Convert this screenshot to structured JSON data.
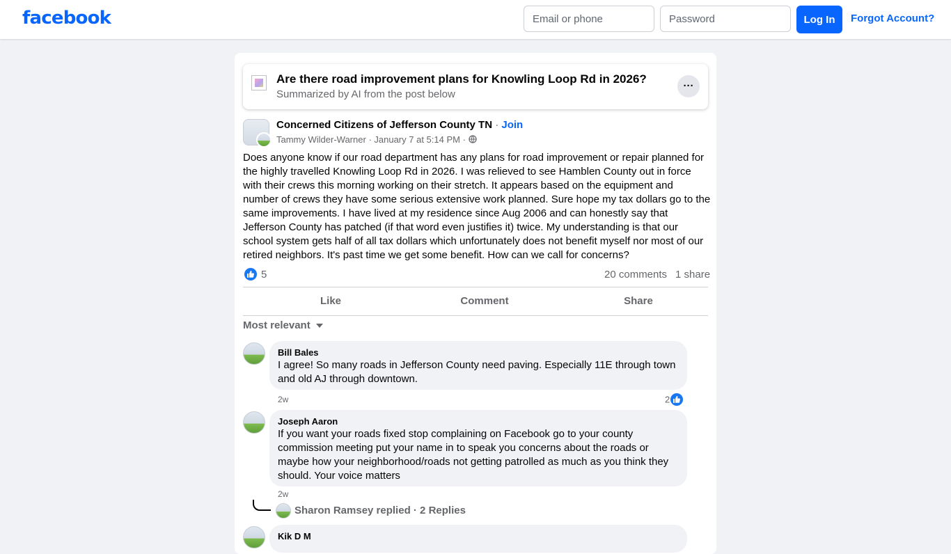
{
  "brand": {
    "logo": "facebook",
    "color": "#0866ff"
  },
  "login": {
    "email_placeholder": "Email or phone",
    "password_placeholder": "Password",
    "login_label": "Log In",
    "forgot_label": "Forgot Account?"
  },
  "summary": {
    "title": "Are there road improvement plans for Knowling Loop Rd in 2026?",
    "subtitle": "Summarized by AI from the post below",
    "more_label": "···"
  },
  "post": {
    "group_name": "Concerned Citizens of Jefferson County TN",
    "join_label": "Join",
    "author": "Tammy Wilder-Warner",
    "timestamp": "January 7 at 5:14 PM",
    "body": "Does anyone know if our road department has any plans for road improvement or repair planned for the highly travelled Knowling Loop Rd in 2026. I was relieved to see Hamblen County out in force with their crews this morning working on their stretch. It appears based on the equipment and number of crews they have some serious extensive work planned. Sure hope my tax dollars go to the same improvements. I have lived  at my residence since Aug 2006 and can honestly say that Jefferson County has patched (if that word even justifies it) twice. My understanding is that our school system gets half of all tax dollars which unfortunately does not benefit myself nor most of our retired neighbors. It's past time we get some benefit. How can we call for concerns?",
    "reaction_count": "5",
    "comments_count": "20 comments",
    "shares_count": "1 share",
    "actions": {
      "like": "Like",
      "comment": "Comment",
      "share": "Share"
    }
  },
  "comments_section": {
    "sort_label": "Most relevant",
    "comments": [
      {
        "author": "Bill Bales",
        "text": "I agree! So many roads in Jefferson County need paving. Especially 11E through town and old AJ through downtown.",
        "time": "2w",
        "likes": "2"
      },
      {
        "author": "Joseph Aaron",
        "text": "If you want your roads fixed stop complaining on Facebook go to your county commission meeting put your name in to speak you concerns about the roads or maybe how your neighborhood/roads not getting patrolled as much as you think they should. Your voice matters",
        "time": "2w"
      },
      {
        "author": "Kik D M"
      }
    ],
    "reply_summary": "Sharon Ramsey replied · 2 Replies"
  },
  "icons": [
    "globe-icon",
    "like-icon",
    "caret-down-icon",
    "more-icon"
  ]
}
